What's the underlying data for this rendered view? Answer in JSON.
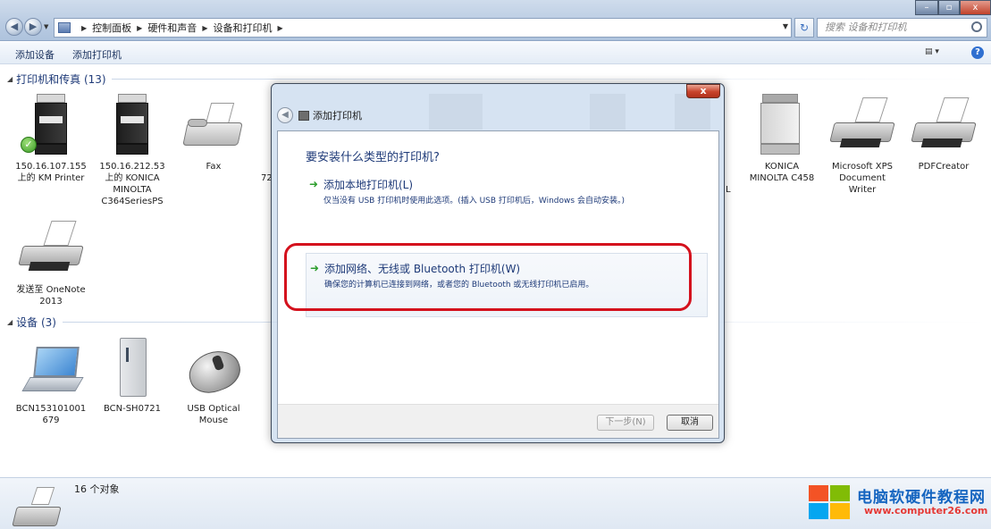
{
  "address": {
    "crumbs": [
      "控制面板",
      "硬件和声音",
      "设备和打印机"
    ],
    "search_placeholder": "搜索 设备和打印机"
  },
  "window_controls": {
    "minimize": "–",
    "maximize": "▫",
    "close": "x"
  },
  "toolbar": {
    "add_device": "添加设备",
    "add_printer": "添加打印机"
  },
  "groups": {
    "printers": {
      "label": "打印机和传真 (13)"
    },
    "devices": {
      "label": "设备 (3)"
    }
  },
  "printers": [
    {
      "label": "150.16.107.155 上的 KM Printer",
      "icon": "mfp-printer-icon",
      "default": true
    },
    {
      "label": "150.16.212.53 上的 KONICA MINOLTA C364SeriesPS",
      "icon": "mfp-printer-icon"
    },
    {
      "label": "Fax",
      "icon": "fax-icon"
    },
    {
      "label": "72",
      "icon": "partial-printer"
    },
    {
      "label": "L",
      "icon": "partial-printer"
    },
    {
      "label": "KONICA MINOLTA C458",
      "icon": "mfp-printer-icon"
    },
    {
      "label": "Microsoft XPS Document Writer",
      "icon": "inkjet-printer-icon"
    },
    {
      "label": "PDFCreator",
      "icon": "inkjet-printer-icon"
    },
    {
      "label": "发送至 OneNote 2013",
      "icon": "inkjet-printer-icon"
    }
  ],
  "devices": [
    {
      "label": "BCN153101001679",
      "icon": "laptop-icon"
    },
    {
      "label": "BCN-SH0721",
      "icon": "tower-icon"
    },
    {
      "label": "USB Optical Mouse",
      "icon": "mouse-icon"
    }
  ],
  "status": {
    "count": "16 个对象"
  },
  "watermark": {
    "title": "电脑软硬件教程网",
    "url": "www.computer26.com"
  },
  "dialog": {
    "close_label": "x",
    "title": "添加打印机",
    "question": "要安装什么类型的打印机?",
    "options": [
      {
        "title": "添加本地打印机(L)",
        "desc": "仅当没有 USB 打印机时使用此选项。(插入 USB 打印机后，Windows 会自动安装。)"
      },
      {
        "title": "添加网络、无线或 Bluetooth 打印机(W)",
        "desc": "确保您的计算机已连接到网络，或者您的 Bluetooth 或无线打印机已启用。"
      }
    ],
    "next_label": "下一步(N)",
    "cancel_label": "取消"
  },
  "colors": {
    "highlight_ring": "#d4111d",
    "link_blue": "#1e3a78",
    "arrow_green": "#2e9e2e"
  }
}
